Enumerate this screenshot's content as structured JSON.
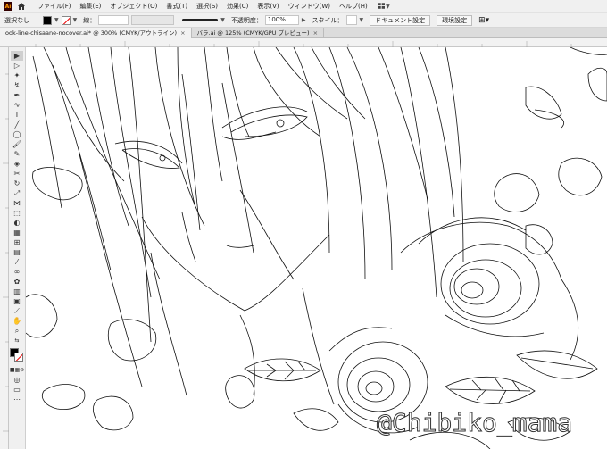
{
  "app": {
    "logo_text": "Ai"
  },
  "menu": [
    "ファイル(F)",
    "編集(E)",
    "オブジェクト(O)",
    "書式(T)",
    "選択(S)",
    "効果(C)",
    "表示(V)",
    "ウィンドウ(W)",
    "ヘルプ(H)"
  ],
  "control": {
    "selection_label": "選択なし",
    "stroke_label": "線：",
    "opacity_label": "不透明度：",
    "opacity_value": "100%",
    "style_label": "スタイル：",
    "doc_settings_button": "ドキュメント設定",
    "env_settings_button": "環境設定"
  },
  "tabs": [
    {
      "label": "ook-line-chisaane-nocover.ai* @ 300% (CMYK/アウトライン)",
      "active": true
    },
    {
      "label": "バラ.ai @ 125% (CMYK/GPU プレビュー)",
      "active": false
    }
  ],
  "watermark": "@Chibiko_mama",
  "colors": {
    "fill": "#000000",
    "stroke_none": "#e00000",
    "canvas": "#ffffff"
  }
}
